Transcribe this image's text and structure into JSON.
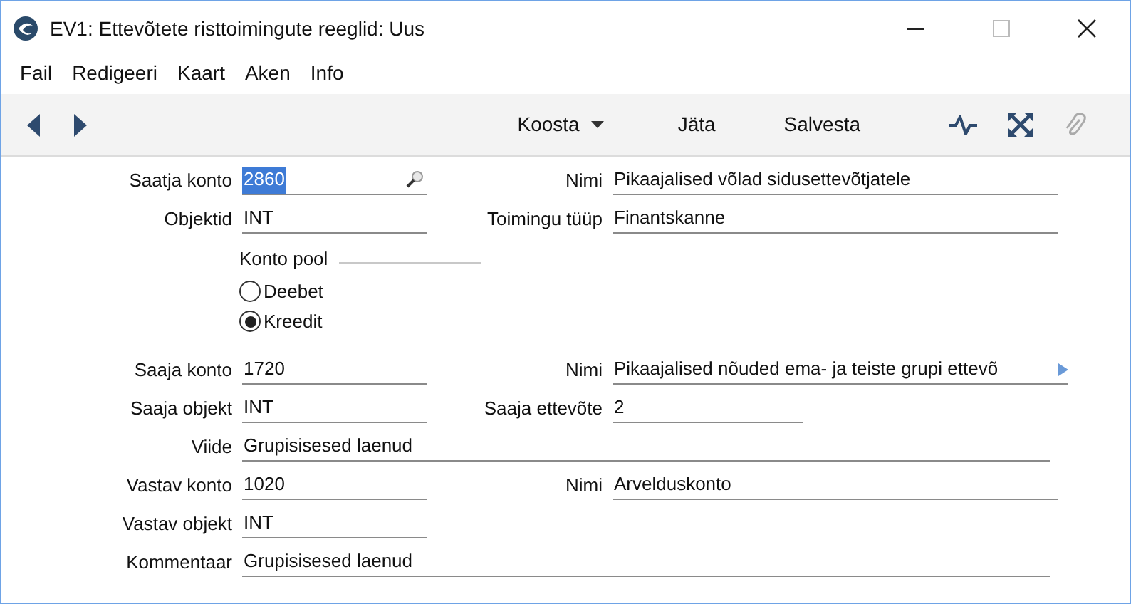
{
  "window": {
    "title": "EV1: Ettevõtete risttoimingute reeglid: Uus"
  },
  "menu": [
    "Fail",
    "Redigeeri",
    "Kaart",
    "Aken",
    "Info"
  ],
  "toolbar": {
    "dropdown": "Koosta",
    "buttons": [
      "Jäta",
      "Salvesta"
    ]
  },
  "rows": [
    {
      "kind": "pair",
      "left": {
        "label": "Saatja konto",
        "value": "2860",
        "selected": true,
        "search": true
      },
      "right": {
        "label": "Nimi",
        "value": "Pikaajalised võlad sidusettevõtjatele",
        "kind": "wide"
      }
    },
    {
      "kind": "pair",
      "left": {
        "label": "Objektid",
        "value": "INT",
        "selected": false,
        "search": false
      },
      "right": {
        "label": "Toimingu tüüp",
        "value": "Finantskanne",
        "kind": "wide"
      }
    },
    {
      "kind": "radio",
      "label": "Konto pool",
      "options": [
        {
          "label": "Deebet",
          "selected": false
        },
        {
          "label": "Kreedit",
          "selected": true
        }
      ]
    },
    {
      "kind": "pair",
      "left": {
        "label": "Saaja konto",
        "value": "1720",
        "selected": false,
        "search": false
      },
      "right": {
        "label": "Nimi",
        "value": "Pikaajalised nõuded ema- ja teiste grupi ettevõ",
        "kind": "overflow"
      }
    },
    {
      "kind": "pair",
      "left": {
        "label": "Saaja objekt",
        "value": "INT",
        "selected": false,
        "search": false
      },
      "right": {
        "label": "Saaja ettevõte",
        "value": "2",
        "kind": "medium"
      }
    },
    {
      "kind": "full",
      "label": "Viide",
      "value": "Grupisisesed laenud"
    },
    {
      "kind": "pair",
      "left": {
        "label": "Vastav konto",
        "value": "1020",
        "selected": false,
        "search": false
      },
      "right": {
        "label": "Nimi",
        "value": "Arvelduskonto",
        "kind": "wide"
      }
    },
    {
      "kind": "single",
      "label": "Vastav objekt",
      "value": "INT"
    },
    {
      "kind": "full",
      "label": "Kommentaar",
      "value": "Grupisisesed laenud"
    }
  ]
}
